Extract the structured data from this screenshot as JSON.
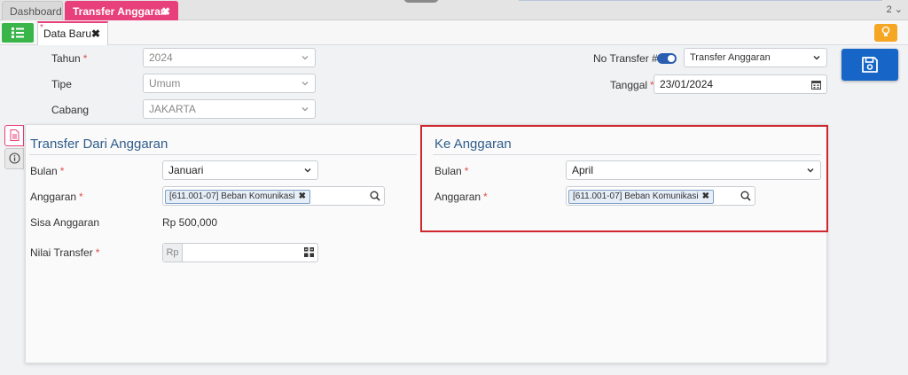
{
  "top_tabs": {
    "dashboard": "Dashboard",
    "active": "Transfer Anggaran",
    "close": "✖",
    "window_count": "2 ⌄"
  },
  "sub_tabs": {
    "marker": "*",
    "data_baru": "Data Baru",
    "close": "✖"
  },
  "header_form": {
    "tahun": {
      "label": "Tahun",
      "value": "2024"
    },
    "tipe": {
      "label": "Tipe",
      "value": "Umum"
    },
    "cabang": {
      "label": "Cabang",
      "value": "JAKARTA"
    },
    "no_transfer": {
      "label": "No Transfer #",
      "value": "Transfer Anggaran"
    },
    "tanggal": {
      "label": "Tanggal",
      "value": "23/01/2024"
    }
  },
  "required_mark": "*",
  "transfer_dari": {
    "title": "Transfer Dari Anggaran",
    "bulan": {
      "label": "Bulan",
      "value": "Januari"
    },
    "anggaran": {
      "label": "Anggaran",
      "tag": "[611.001-07] Beban Komunikasi",
      "tag_remove": "✖"
    },
    "sisa": {
      "label": "Sisa Anggaran",
      "value": "Rp 500,000"
    },
    "nilai_transfer": {
      "label": "Nilai Transfer",
      "prefix": "Rp",
      "value": ""
    }
  },
  "ke_anggaran": {
    "title": "Ke Anggaran",
    "bulan": {
      "label": "Bulan",
      "value": "April"
    },
    "anggaran": {
      "label": "Anggaran",
      "tag": "[611.001-07] Beban Komunikasi",
      "tag_remove": "✖"
    }
  },
  "colors": {
    "accent_pink": "#e8407a",
    "primary_blue": "#1766c7",
    "green": "#39b54a",
    "orange": "#f5a623",
    "highlight_red": "#d0262e",
    "section_title": "#2f5d8a"
  },
  "icons": [
    "list-icon",
    "lightbulb-icon",
    "save-icon",
    "document-icon",
    "info-icon",
    "calendar-icon",
    "search-icon",
    "calculator-icon",
    "chevron-down-icon"
  ]
}
